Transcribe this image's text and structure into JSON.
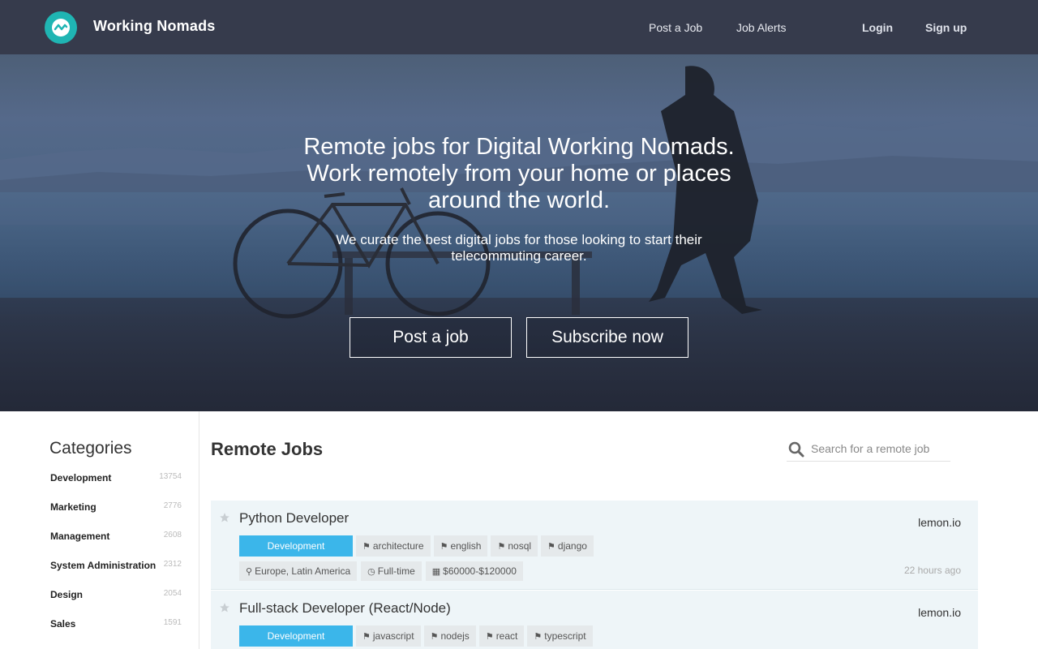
{
  "brand": {
    "name": "Working Nomads"
  },
  "nav": {
    "post_job": "Post a Job",
    "job_alerts": "Job Alerts",
    "login": "Login",
    "signup": "Sign up"
  },
  "hero": {
    "title": "Remote jobs for Digital Working Nomads. Work remotely from your home or places around the world.",
    "subtitle": "We curate the best digital jobs for those looking to start their telecommuting career.",
    "post_button": "Post a job",
    "subscribe_button": "Subscribe now"
  },
  "sidebar": {
    "title": "Categories",
    "items": [
      {
        "name": "Development",
        "count": "13754"
      },
      {
        "name": "Marketing",
        "count": "2776"
      },
      {
        "name": "Management",
        "count": "2608"
      },
      {
        "name": "System Administration",
        "count": "2312"
      },
      {
        "name": "Design",
        "count": "2054"
      },
      {
        "name": "Sales",
        "count": "1591"
      }
    ]
  },
  "main": {
    "title": "Remote Jobs",
    "search_placeholder": "Search for a remote job"
  },
  "jobs": [
    {
      "title": "Python Developer",
      "company": "lemon.io",
      "category": "Development",
      "tags": [
        "architecture",
        "english",
        "nosql",
        "django"
      ],
      "location": "Europe, Latin America",
      "type": "Full-time",
      "salary": "$60000-$120000",
      "age": "22 hours ago"
    },
    {
      "title": "Full-stack Developer (React/Node)",
      "company": "lemon.io",
      "category": "Development",
      "tags": [
        "javascript",
        "nodejs",
        "react",
        "typescript"
      ]
    }
  ],
  "colors": {
    "navbar": "#363b4c",
    "logo": "#1fb5b3",
    "category_pill": "#3bb6ea",
    "job_bg": "#eef5f8"
  },
  "icons": {
    "logo": "trend-wave-icon",
    "search": "search-icon",
    "star": "star-icon",
    "tag": "tags-icon",
    "location": "map-marker-icon",
    "clock": "clock-icon",
    "money": "money-icon"
  }
}
